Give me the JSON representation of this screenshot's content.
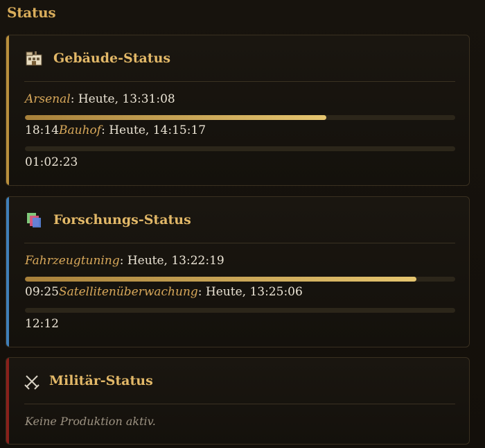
{
  "page": {
    "title": "Status"
  },
  "buildings": {
    "title": "Gebäude-Status",
    "icon": "building-icon",
    "items": [
      {
        "name": "Arsenal",
        "finish": ": Heute, 13:31:08",
        "remaining": "18:14",
        "progress": 0.7
      },
      {
        "name": "Bauhof",
        "finish": ": Heute, 14:15:17",
        "remaining": "01:02:23",
        "progress": 0.0
      }
    ]
  },
  "research": {
    "title": "Forschungs-Status",
    "icon": "research-books-icon",
    "items": [
      {
        "name": "Fahrzeugtuning",
        "finish": ": Heute, 13:22:19",
        "remaining": "09:25",
        "progress": 0.91
      },
      {
        "name": "Satellitenüberwachung",
        "finish": ": Heute, 13:25:06",
        "remaining": "12:12",
        "progress": 0.0
      }
    ]
  },
  "military": {
    "title": "Militär-Status",
    "icon": "crossed-swords-icon",
    "empty_text": "Keine Produktion aktiv."
  },
  "colors": {
    "gold_accent": "#b98f3c",
    "blue_accent": "#3f7fb9",
    "red_accent": "#8a1f1a",
    "title_gold": "#e2b868"
  }
}
